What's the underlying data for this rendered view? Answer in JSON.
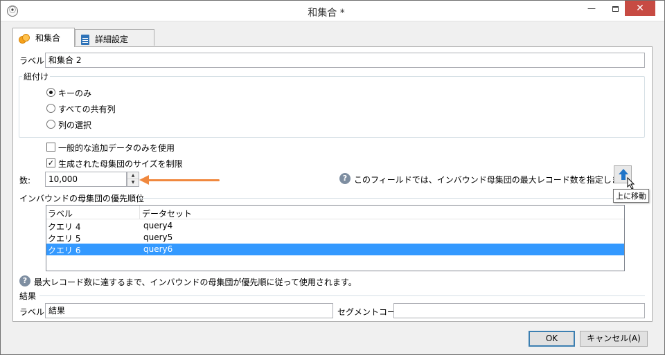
{
  "window": {
    "title": "和集合 *",
    "minimize_label": "—",
    "close_label": "✕"
  },
  "tabs": [
    {
      "label": "和集合",
      "icon": "union-icon"
    },
    {
      "label": "詳細設定",
      "icon": "clipboard-icon"
    }
  ],
  "form": {
    "label_caption": "ラベル:",
    "label_value": "和集合 2",
    "join_group_title": "紐付け",
    "radios": [
      {
        "label": "キーのみ",
        "checked": true
      },
      {
        "label": "すべての共有列",
        "checked": false
      },
      {
        "label": "列の選択",
        "checked": false
      }
    ],
    "checkboxes": [
      {
        "label": "一般的な追加データのみを使用",
        "checked": false,
        "mark": ""
      },
      {
        "label": "生成された母集団のサイズを制限",
        "checked": true,
        "mark": "✓"
      }
    ],
    "count_caption": "数:",
    "count_value": "10,000",
    "count_help": "このフィールドでは、インバウンド母集団の最大レコード数を指定します。",
    "priority_section_title": "インバウンドの母集団の優先順位",
    "table": {
      "columns": [
        "ラベル",
        "データセット"
      ],
      "rows": [
        {
          "label": "クエリ 4",
          "dataset": "query4",
          "selected": false
        },
        {
          "label": "クエリ 5",
          "dataset": "query5",
          "selected": false
        },
        {
          "label": "クエリ 6",
          "dataset": "query6",
          "selected": true
        }
      ]
    },
    "move_up_tooltip": "上に移動",
    "priority_help": "最大レコード数に達するまで、インバウンドの母集団が優先順に従って使用されます。",
    "result_section_title": "結果",
    "result_label_caption": "ラベル:",
    "result_label_value": "結果",
    "segment_code_caption": "セグメントコード:",
    "segment_code_value": ""
  },
  "buttons": {
    "ok": "OK",
    "cancel": "キャンセル(A)"
  },
  "colors": {
    "annotation_arrow": "#f0883e",
    "selection": "#3399ff",
    "close_button": "#c74b43"
  }
}
